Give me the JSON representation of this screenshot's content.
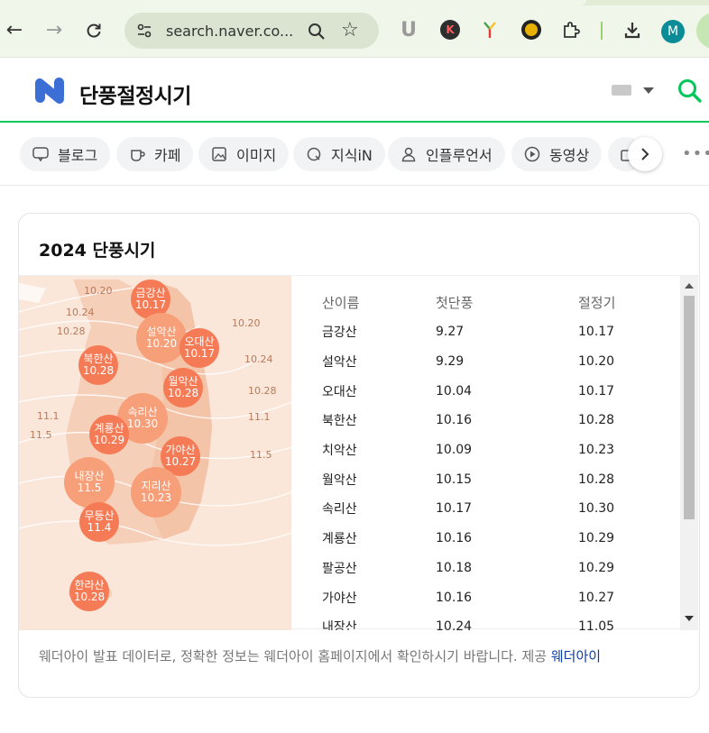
{
  "browser": {
    "url": "search.naver.co...",
    "profile_initial": "M",
    "ext_k": "K"
  },
  "search": {
    "query": "단풍절정시기"
  },
  "chips": [
    "블로그",
    "카페",
    "이미지",
    "지식iN",
    "인플루언서",
    "동영상"
  ],
  "card": {
    "title": "2024 단풍시기",
    "columns": [
      "산이름",
      "첫단풍",
      "절정기"
    ],
    "rows": [
      [
        "금강산",
        "9.27",
        "10.17"
      ],
      [
        "설악산",
        "9.29",
        "10.20"
      ],
      [
        "오대산",
        "10.04",
        "10.17"
      ],
      [
        "북한산",
        "10.16",
        "10.28"
      ],
      [
        "치악산",
        "10.09",
        "10.23"
      ],
      [
        "월악산",
        "10.15",
        "10.28"
      ],
      [
        "속리산",
        "10.17",
        "10.30"
      ],
      [
        "계룡산",
        "10.16",
        "10.29"
      ],
      [
        "팔공산",
        "10.18",
        "10.29"
      ],
      [
        "가야산",
        "10.16",
        "10.27"
      ],
      [
        "내장산",
        "10.24",
        "11.05"
      ]
    ],
    "footnote": "웨더아이 발표 데이터로, 정확한 정보는 웨더아이 홈페이지에서 확인하시기 바랍니다. 제공",
    "provider": "웨더아이"
  },
  "map": {
    "bubbles": [
      {
        "name": "금강산",
        "date": "10.17"
      },
      {
        "name": "설악산",
        "date": "10.20"
      },
      {
        "name": "오대산",
        "date": "10.17"
      },
      {
        "name": "북한산",
        "date": "10.28"
      },
      {
        "name": "월악산",
        "date": "10.28"
      },
      {
        "name": "속리산",
        "date": "10.30"
      },
      {
        "name": "계룡산",
        "date": "10.29"
      },
      {
        "name": "가야산",
        "date": "10.27"
      },
      {
        "name": "내장산",
        "date": "11.5"
      },
      {
        "name": "지리산",
        "date": "10.23"
      },
      {
        "name": "무등산",
        "date": "11.4"
      },
      {
        "name": "한라산",
        "date": "10.28"
      }
    ],
    "isolines": [
      "10.20",
      "10.24",
      "10.28",
      "10.20",
      "10.24",
      "10.28",
      "11.1",
      "11.5",
      "11.1",
      "11.5"
    ]
  },
  "colors": {
    "naver_green": "#03c75a",
    "bubble_dark": "#f47b55",
    "bubble_light": "#f79f79",
    "map_bg": "#fbe6da",
    "provider_link": "#0d3ea8"
  }
}
